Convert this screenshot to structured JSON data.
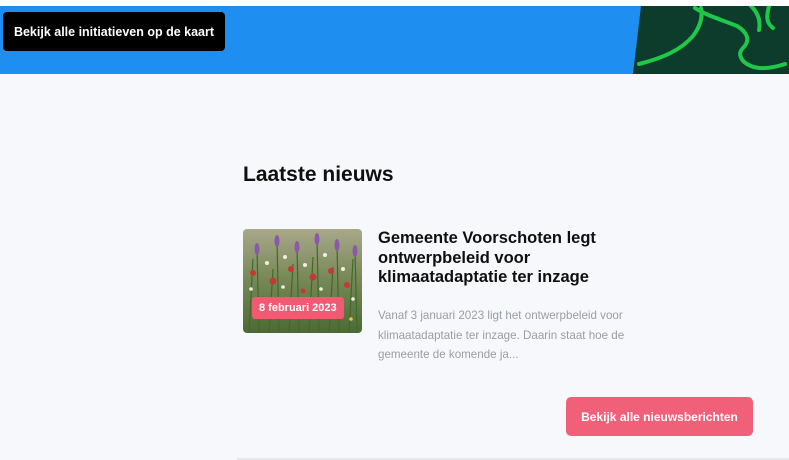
{
  "hero": {
    "map_button_label": "Bekijk alle initiatieven op de kaart",
    "band_color": "#1f8ef1",
    "graphic_bg_color": "#0d3b2c",
    "graphic_line_color": "#20c84a"
  },
  "news_section": {
    "title": "Laatste nieuws",
    "articles": [
      {
        "date": "8 februari 2023",
        "headline": "Gemeente Voorschoten legt ontwerpbeleid voor klimaatadaptatie ter inzage",
        "excerpt": "Vanaf 3 januari 2023 ligt het ontwerpbeleid voor klimaatadaptatie ter inzage. Daarin staat hoe de gemeente de komende ja...",
        "image": "wildflower-meadow-photo"
      }
    ],
    "all_news_button_label": "Bekijk alle nieuwsberichten",
    "accent_color": "#f06079"
  }
}
